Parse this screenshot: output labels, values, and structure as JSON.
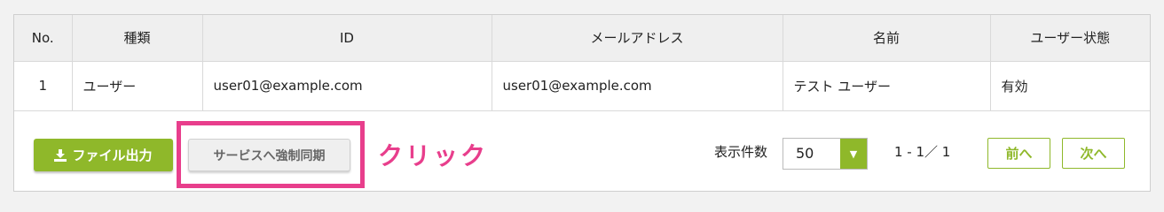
{
  "table": {
    "columns": [
      "No.",
      "種類",
      "ID",
      "メールアドレス",
      "名前",
      "ユーザー状態"
    ],
    "rows": [
      [
        "1",
        "ユーザー",
        "user01@example.com",
        "user01@example.com",
        "テスト ユーザー",
        "有効"
      ]
    ]
  },
  "actions": {
    "export_label": "ファイル出力",
    "export_icon": "download-icon",
    "sync_label": "サービスへ強制同期",
    "annotation_label": "クリック"
  },
  "pagination": {
    "per_page_label": "表示件数",
    "per_page_value": "50",
    "range": "1 - 1／ 1",
    "prev_label": "前へ",
    "next_label": "次へ"
  },
  "colors": {
    "accent": "#8fb82a",
    "annotation": "#e83e8c",
    "header_bg": "#efefef"
  }
}
